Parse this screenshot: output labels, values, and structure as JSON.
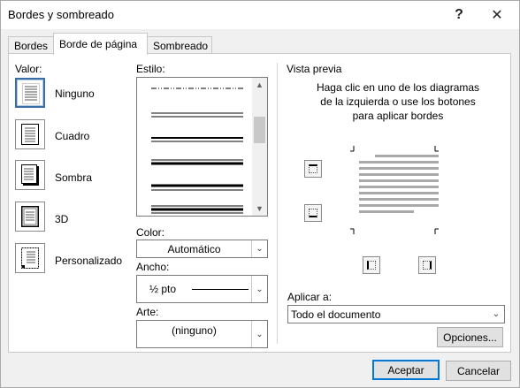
{
  "window": {
    "title": "Bordes y sombreado"
  },
  "tabs": [
    {
      "label": "Bordes"
    },
    {
      "label": "Borde de página",
      "active": true
    },
    {
      "label": "Sombreado"
    }
  ],
  "valor": {
    "label": "Valor:",
    "options": [
      {
        "label": "Ninguno",
        "icon": "no-border-page-icon",
        "selected": true
      },
      {
        "label": "Cuadro",
        "icon": "box-border-page-icon"
      },
      {
        "label": "Sombra",
        "icon": "shadow-border-page-icon"
      },
      {
        "label": "3D",
        "icon": "3d-border-page-icon"
      },
      {
        "label": "Personalizado",
        "icon": "custom-border-page-icon"
      }
    ]
  },
  "estilo": {
    "label": "Estilo:"
  },
  "color": {
    "label": "Color:",
    "value": "Automático"
  },
  "ancho": {
    "label": "Ancho:",
    "value": "½ pto"
  },
  "arte": {
    "label": "Arte:",
    "value": "(ninguno)"
  },
  "preview": {
    "label": "Vista previa",
    "instructions": "Haga clic en uno de los diagramas de la izquierda o use los botones para aplicar bordes"
  },
  "apply": {
    "label": "Aplicar a:",
    "value": "Todo el documento"
  },
  "buttons": {
    "options": "Opciones...",
    "ok": "Aceptar",
    "cancel": "Cancelar"
  },
  "colors": {
    "accent": "#0078d7",
    "selected_border": "#3a6ea5"
  }
}
